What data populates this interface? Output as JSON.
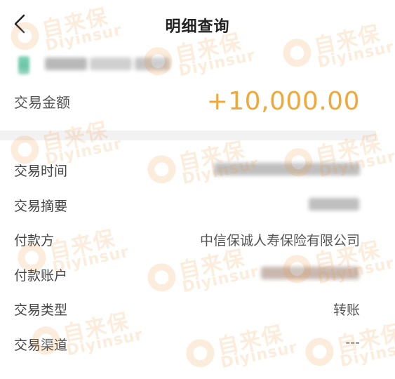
{
  "header": {
    "title": "明细查询"
  },
  "summary": {
    "amount_label": "交易金额",
    "amount_value": "+10,000.00"
  },
  "details": [
    {
      "label": "交易时间",
      "value": ""
    },
    {
      "label": "交易摘要",
      "value": ""
    },
    {
      "label": "付款方",
      "value": "中信保诚人寿保险有限公司"
    },
    {
      "label": "付款账户",
      "value": ""
    },
    {
      "label": "交易类型",
      "value": "转账"
    },
    {
      "label": "交易渠道",
      "value": "---"
    }
  ],
  "watermark": {
    "cn": "自来保",
    "en": "Diyinsur"
  },
  "colors": {
    "amount": "#f0a83a",
    "watermark": "#f39a3c",
    "divider": "#f2f2f2"
  },
  "icons": {
    "back": "chevron-left-icon",
    "watermark_logo": "brand-logo-icon"
  }
}
